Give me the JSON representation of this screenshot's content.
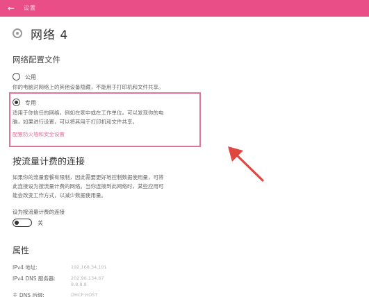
{
  "window": {
    "title": "设置",
    "back_icon": "arrow-left-icon"
  },
  "header": {
    "title": "网络 4",
    "icon": "network-icon"
  },
  "network_profile": {
    "heading": "网络配置文件",
    "public_option": {
      "label": "公用",
      "selected": false,
      "description": "你的电脑对网络上的其他设备隐藏，不能用于打印机和文件共享。"
    },
    "private_option": {
      "label": "专用",
      "selected": true,
      "description_line1": "适用于你信任的网络，例如在家中或在工作单位。可以发现你的电",
      "description_line2": "脑，如果进行设置，可以将其用于打印机和文件共享。"
    },
    "firewall_link": "配置防火墙和安全设置"
  },
  "metered": {
    "heading": "按流量计费的连接",
    "description_line1": "如果你的流量套餐有限制，因此需要更好地控制数据使用量，可将",
    "description_line2": "此连接设为按流量计费的网络。当你连接到此网络时，某些应用可",
    "description_line3": "能会改变工作方式，以减少数据使用量。",
    "toggle_label": "设为按流量计费的连接",
    "toggle_state": "关",
    "toggle_on": false
  },
  "properties": {
    "heading": "属性",
    "rows": [
      {
        "key": "IPv4 地址:",
        "value": "192.168.34.101"
      },
      {
        "key": "IPv4 DNS 服务器:",
        "value": "202.96.134.67",
        "value2": "8.8.8.8"
      },
      {
        "key": "主 DNS 后缀:",
        "value": "DHCP HOST"
      }
    ]
  },
  "colors": {
    "accent": "#e94f86",
    "highlight": "#e0739c",
    "annotation_arrow": "#e0473f"
  }
}
